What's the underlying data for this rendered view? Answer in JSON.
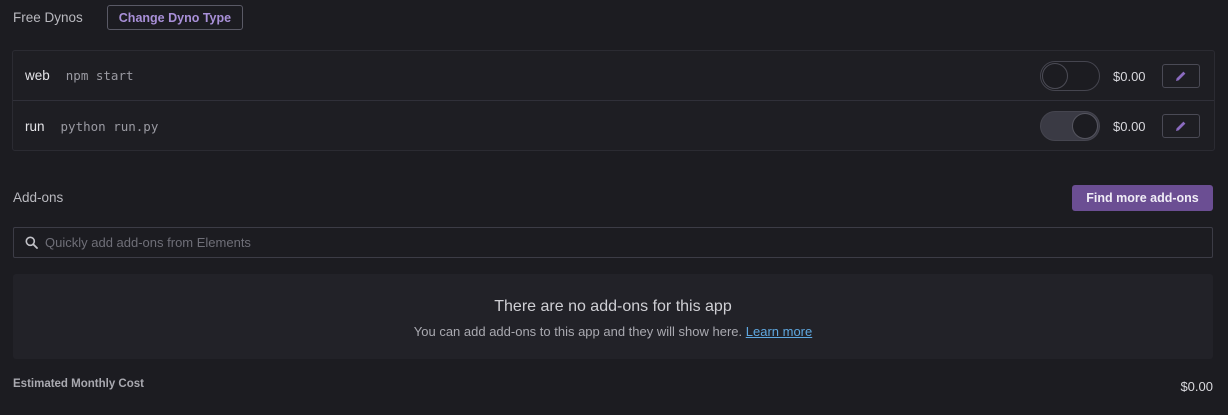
{
  "dynos": {
    "section_label": "Free Dynos",
    "change_button_label": "Change Dyno Type",
    "rows": [
      {
        "name": "web",
        "command": "npm start",
        "enabled": false,
        "price": "$0.00"
      },
      {
        "name": "run",
        "command": "python run.py",
        "enabled": true,
        "price": "$0.00"
      }
    ]
  },
  "addons": {
    "section_label": "Add-ons",
    "find_button_label": "Find more add-ons",
    "search_placeholder": "Quickly add add-ons from Elements",
    "empty_title": "There are no add-ons for this app",
    "empty_description": "You can add add-ons to this app and they will show here.",
    "learn_more_label": "Learn more"
  },
  "cost": {
    "label": "Estimated Monthly Cost",
    "value": "$0.00"
  },
  "colors": {
    "background": "#1c1c21",
    "accent": "#6b4e93",
    "accent_text": "#a990d8",
    "link": "#5fa8e0"
  }
}
